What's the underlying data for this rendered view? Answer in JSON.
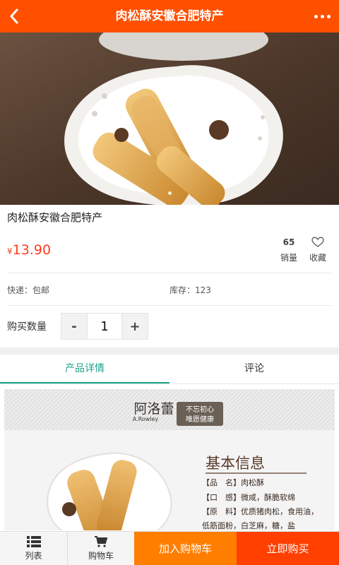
{
  "header": {
    "title": "肉松酥安徽合肥特产"
  },
  "product": {
    "name": "肉松酥安徽合肥特产",
    "currency": "¥",
    "price": "13.90",
    "sales_count": "65",
    "sales_label": "销量",
    "favorite_label": "收藏",
    "shipping": "快递：包邮",
    "stock": "库存：123"
  },
  "quantity": {
    "label": "购买数量",
    "minus": "-",
    "value": "1",
    "plus": "+"
  },
  "tabs": [
    {
      "label": "产品详情",
      "active": true
    },
    {
      "label": "评论",
      "active": false
    }
  ],
  "detail_image": {
    "brand_cn": "阿洛蕾",
    "brand_en": "A.Rowley",
    "slogan_1": "不忘初心",
    "slogan_2": "唯愿健康",
    "heading": "基本信息",
    "lines": [
      "【品　名】肉松酥",
      "【口　感】微咸，酥脆软绵",
      "【原　料】优质猪肉松，食用油，",
      "低筋面粉，白芝麻，糖，盐"
    ]
  },
  "bottom_bar": {
    "list_label": "列表",
    "cart_label": "购物车",
    "add_to_cart": "加入购物车",
    "buy_now": "立即购买"
  },
  "colors": {
    "brand": "#ff5000",
    "price": "#ff3b1f",
    "tab_active": "#1ca58a",
    "cart_button": "#ff7e00",
    "buy_button": "#ff4000"
  }
}
